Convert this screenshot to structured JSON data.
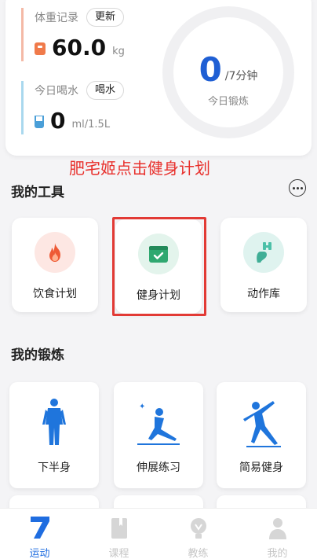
{
  "stats": {
    "weight": {
      "label": "体重记录",
      "button": "更新",
      "value": "60.0",
      "unit": "kg"
    },
    "water": {
      "label": "今日喝水",
      "button": "喝水",
      "value": "0",
      "unit": "ml/1.5L"
    },
    "exercise": {
      "value": "0",
      "unit": "/7分钟",
      "label": "今日锻炼"
    }
  },
  "annotation": "肥宅姬点击健身计划",
  "tools": {
    "title": "我的工具",
    "items": [
      {
        "label": "饮食计划",
        "icon": "flame-icon"
      },
      {
        "label": "健身计划",
        "icon": "calendar-check-icon"
      },
      {
        "label": "动作库",
        "icon": "dumbbell-arm-icon"
      }
    ]
  },
  "exercise": {
    "title": "我的锻炼",
    "items": [
      {
        "label": "下半身",
        "icon": "body-figure-icon"
      },
      {
        "label": "伸展练习",
        "icon": "stretch-figure-icon"
      },
      {
        "label": "简易健身",
        "icon": "jump-figure-icon"
      }
    ]
  },
  "nav": {
    "items": [
      {
        "label": "运动",
        "icon": "seven-logo-icon",
        "active": true
      },
      {
        "label": "课程",
        "icon": "book-icon",
        "active": false
      },
      {
        "label": "教练",
        "icon": "coach-icon",
        "active": false
      },
      {
        "label": "我的",
        "icon": "person-icon",
        "active": false
      }
    ]
  },
  "colors": {
    "accent": "#1f6de0",
    "highlight": "#e23a35",
    "annotation": "#e8302c"
  }
}
